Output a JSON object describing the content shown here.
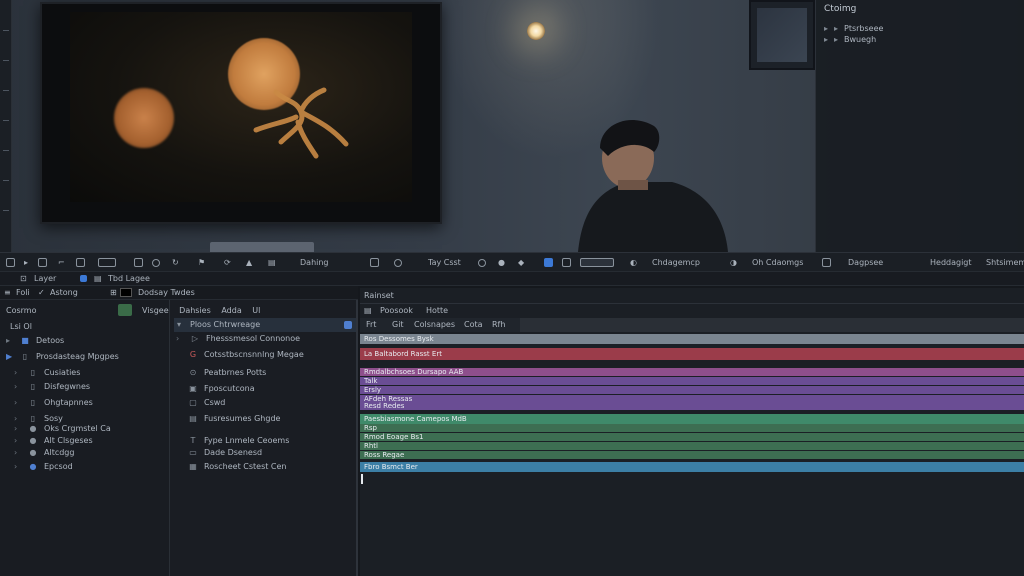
{
  "colors": {
    "track_gray": "#7a8590",
    "track_red": "#9b3c4a",
    "track_magenta": "#8e4f8c",
    "track_purple": "#6a4d94",
    "track_teal": "#3f8a6a",
    "track_green": "#3d6e52",
    "track_blue": "#3c7fa6",
    "accent_blue": "#3c79d6"
  },
  "effects_panel": {
    "title": "Ctoimg",
    "items": [
      "Ptsrbseee",
      "Bwuegh"
    ]
  },
  "toolbar": {
    "dahing": "Dahing",
    "tay_cset": "Tay Csst",
    "chdagemcp": "Chdagemcp",
    "oh_cdaomgs": "Oh Cdaomgs",
    "dagpsee": "Dagpsee",
    "hitdagigt": "Heddagigt",
    "shtsimem": "Shtsimem"
  },
  "layer_strip": {
    "layer": "Layer",
    "tab_layer": "Tbd Lagee"
  },
  "panel_header": {
    "fol": "Foli",
    "astong": "Astong",
    "display": "Dodsay Twdes"
  },
  "project_panel": {
    "title": "Cosrmo",
    "sub1": "Lsi Ol",
    "sub2": "Detoos",
    "items": [
      "Prosdasteag Mpgpes",
      "Cusiaties",
      "Disfegwnes",
      "Ohgtapnnes",
      "Sosy",
      "Oks Crgmstel Ca",
      "Alt Clsgeses",
      "Altcdgg",
      "Epcsod"
    ]
  },
  "media_panel": {
    "tabs": [
      "Visgee",
      "Dahsies",
      "Adda",
      "Ul"
    ],
    "header": "Ploos Chtrwreage",
    "items": [
      "Fhesssmesol Connonoe",
      "Cotsstbscnsnnlng Megae",
      "Peatbrnes Potts",
      "Fposcutcona",
      "Cswd",
      "Fusresumes Ghgde",
      "Fype Lnmele Ceoems",
      "Dade Dsenesd",
      "Roscheet Cstest Cen"
    ]
  },
  "timeline": {
    "panel_title": "Rainset",
    "menu": [
      "Poosook",
      "Hotte"
    ],
    "tabs": [
      "Frt",
      "Git",
      "Colsnapes",
      "Cota",
      "Rfh"
    ],
    "tracks": [
      {
        "label": "Ros Dessomes Bysk",
        "color": "track_gray"
      },
      {
        "label": "La Baltabord Rasst Ert",
        "color": "track_red"
      },
      {
        "label": "Rmdalbchsoes Dursapo AAB",
        "color": "track_magenta"
      },
      {
        "label": "Talk",
        "color": "track_purple"
      },
      {
        "label": "Ersly",
        "color": "track_purple"
      },
      {
        "label": "AFdeh Ressas",
        "color": "track_purple"
      },
      {
        "label": "Resd Redes",
        "color": "track_purple"
      },
      {
        "label": "Paesbiasmone Camepos MdB",
        "color": "track_teal"
      },
      {
        "label": "Rsp",
        "color": "track_green"
      },
      {
        "label": "Rmod Eoage Bs1",
        "color": "track_green"
      },
      {
        "label": "Rhtl",
        "color": "track_green"
      },
      {
        "label": "Ross Regae",
        "color": "track_green"
      },
      {
        "label": "Fbro Bsmct Ber",
        "color": "track_blue"
      }
    ]
  }
}
